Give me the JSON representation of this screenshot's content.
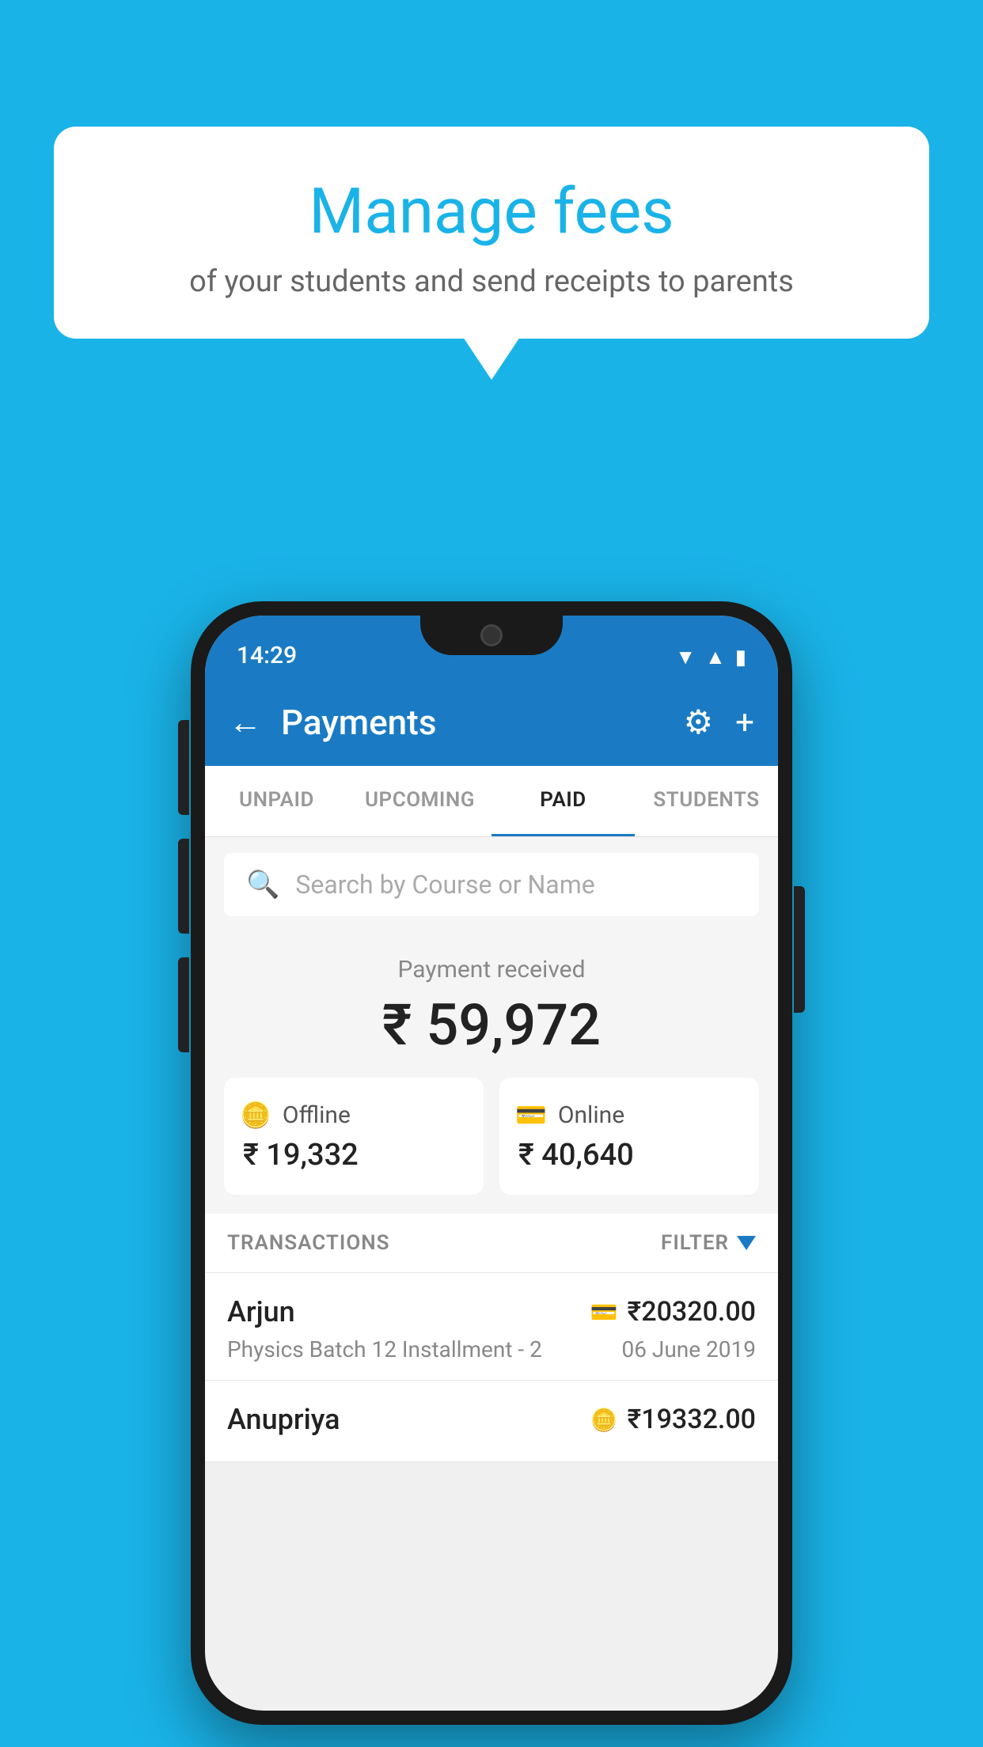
{
  "background": "#1ab3e8",
  "bubble": {
    "title": "Manage fees",
    "subtitle": "of your students and send receipts to parents"
  },
  "phone": {
    "status_bar": {
      "time": "14:29"
    },
    "app_bar": {
      "title": "Payments",
      "back_label": "←",
      "settings_label": "⚙",
      "add_label": "+"
    },
    "tabs": [
      {
        "label": "UNPAID",
        "active": false
      },
      {
        "label": "UPCOMING",
        "active": false
      },
      {
        "label": "PAID",
        "active": true
      },
      {
        "label": "STUDENTS",
        "active": false
      }
    ],
    "search": {
      "placeholder": "Search by Course or Name"
    },
    "payment_summary": {
      "label": "Payment received",
      "amount": "₹ 59,972",
      "offline": {
        "type": "Offline",
        "amount": "₹ 19,332"
      },
      "online": {
        "type": "Online",
        "amount": "₹ 40,640"
      }
    },
    "transactions_section": {
      "label": "TRANSACTIONS",
      "filter_label": "FILTER"
    },
    "transactions": [
      {
        "name": "Arjun",
        "course": "Physics Batch 12 Installment - 2",
        "amount": "₹20320.00",
        "date": "06 June 2019",
        "payment_type": "online"
      },
      {
        "name": "Anupriya",
        "course": "",
        "amount": "₹19332.00",
        "date": "",
        "payment_type": "offline"
      }
    ]
  }
}
